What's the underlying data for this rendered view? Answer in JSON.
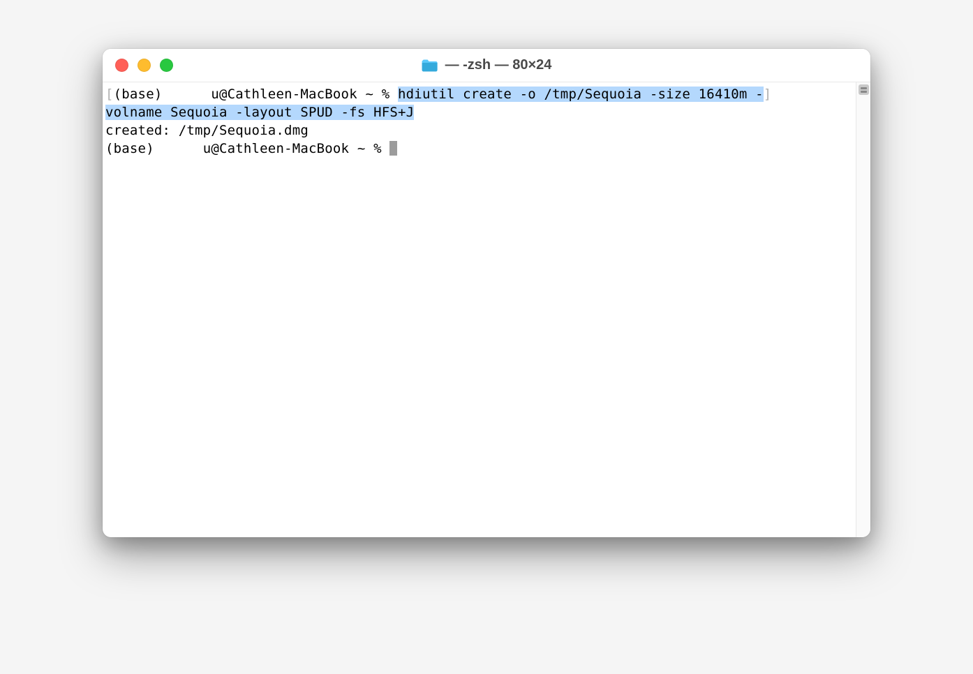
{
  "window": {
    "title": "— -zsh — 80×24"
  },
  "terminal": {
    "line1": {
      "open_bracket": "[",
      "prompt_pre_user": "(base) ",
      "user_redacted": "     ",
      "prompt_post_user": "u@Cathleen-MacBook ~ % ",
      "cmd_part1": "hdiutil create -o /tmp/Sequoia -size 16410m -",
      "close_bracket": "]"
    },
    "line2": {
      "cmd_part2": "volname Sequoia -layout SPUD -fs HFS+J"
    },
    "line3": "created: /tmp/Sequoia.dmg",
    "line4": {
      "prompt_pre_user": "(base) ",
      "user_redacted": "     ",
      "prompt_post_user": "u@Cathleen-MacBook ~ % "
    }
  }
}
